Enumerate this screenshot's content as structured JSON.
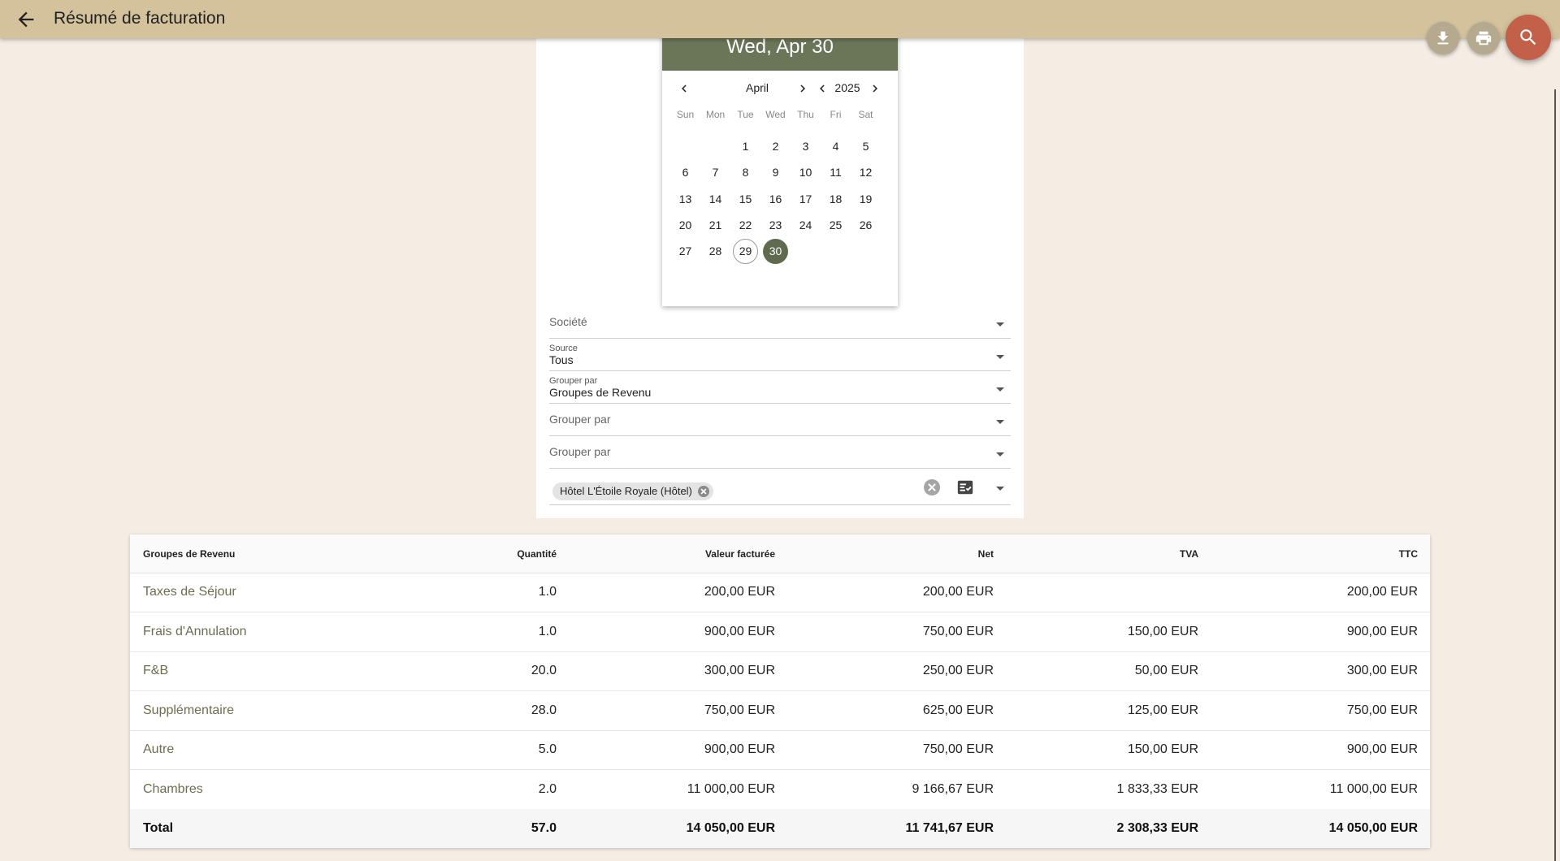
{
  "header": {
    "title": "Résumé de facturation"
  },
  "icons": {
    "back": "arrow-left-icon",
    "download": "download-icon",
    "print": "printer-icon",
    "search": "search-icon"
  },
  "colors": {
    "topbar": "#d3c29c",
    "background": "#f5ede4",
    "calendar_header": "#6b7558",
    "selected_day": "#5f6a4e",
    "search_fab": "#c2604a",
    "fab": "#b5a98f",
    "row_label": "#6d6d50"
  },
  "calendar": {
    "selected_label": "Wed, Apr 30",
    "month": "April",
    "year": "2025",
    "weekdays": [
      "Sun",
      "Mon",
      "Tue",
      "Wed",
      "Thu",
      "Fri",
      "Sat"
    ],
    "weeks": [
      [
        "",
        "",
        "1",
        "2",
        "3",
        "4",
        "5"
      ],
      [
        "6",
        "7",
        "8",
        "9",
        "10",
        "11",
        "12"
      ],
      [
        "13",
        "14",
        "15",
        "16",
        "17",
        "18",
        "19"
      ],
      [
        "20",
        "21",
        "22",
        "23",
        "24",
        "25",
        "26"
      ],
      [
        "27",
        "28",
        "29",
        "30",
        "",
        "",
        ""
      ]
    ],
    "today": "29",
    "selected": "30"
  },
  "filters": {
    "societe_label": "Société",
    "source": {
      "label": "Source",
      "value": "Tous"
    },
    "group1": {
      "label": "Grouper par",
      "value": "Groupes de Revenu"
    },
    "group2_label": "Grouper par",
    "group3_label": "Grouper par",
    "property_chip": "Hôtel L'Étoile Royale (Hôtel)"
  },
  "table": {
    "headers": [
      "Groupes de Revenu",
      "Quantité",
      "Valeur facturée",
      "Net",
      "TVA",
      "TTC"
    ],
    "rows": [
      [
        "Taxes de Séjour",
        "1.0",
        "200,00 EUR",
        "200,00 EUR",
        "",
        "200,00 EUR"
      ],
      [
        "Frais d'Annulation",
        "1.0",
        "900,00 EUR",
        "750,00 EUR",
        "150,00 EUR",
        "900,00 EUR"
      ],
      [
        "F&B",
        "20.0",
        "300,00 EUR",
        "250,00 EUR",
        "50,00 EUR",
        "300,00 EUR"
      ],
      [
        "Supplémentaire",
        "28.0",
        "750,00 EUR",
        "625,00 EUR",
        "125,00 EUR",
        "750,00 EUR"
      ],
      [
        "Autre",
        "5.0",
        "900,00 EUR",
        "750,00 EUR",
        "150,00 EUR",
        "900,00 EUR"
      ],
      [
        "Chambres",
        "2.0",
        "11 000,00 EUR",
        "9 166,67 EUR",
        "1 833,33 EUR",
        "11 000,00 EUR"
      ]
    ],
    "total": [
      "Total",
      "57.0",
      "14 050,00 EUR",
      "11 741,67 EUR",
      "2 308,33 EUR",
      "14 050,00 EUR"
    ]
  }
}
